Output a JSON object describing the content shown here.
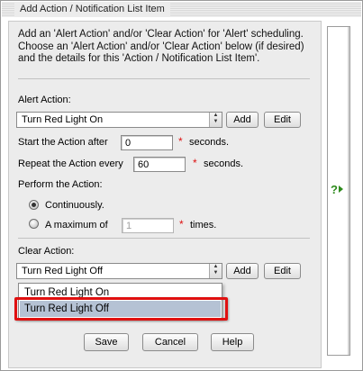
{
  "window": {
    "title": "Add Action / Notification List Item"
  },
  "intro": {
    "text": "Add an 'Alert Action' and/or 'Clear Action' for 'Alert' scheduling. Choose an 'Alert Action' and/or 'Clear Action' below (if desired) and the details for this 'Action / Notification List Item'."
  },
  "alert_action": {
    "label": "Alert Action:",
    "selected": "Turn Red Light On",
    "add_label": "Add",
    "edit_label": "Edit"
  },
  "start_after": {
    "label": "Start the Action after",
    "value": "0",
    "required_mark": "*",
    "unit": "seconds."
  },
  "repeat_every": {
    "label": "Repeat the Action every",
    "value": "60",
    "required_mark": "*",
    "unit": "seconds."
  },
  "perform": {
    "label": "Perform the Action:",
    "continuously_label": "Continuously.",
    "maximum_label": "A maximum of",
    "maximum_value": "1",
    "required_mark": "*",
    "times_unit": "times.",
    "selected_option": "continuously"
  },
  "clear_action": {
    "label": "Clear Action:",
    "selected": "Turn Red Light Off",
    "add_label": "Add",
    "edit_label": "Edit",
    "options": [
      "Turn Red Light On",
      "Turn Red Light Off"
    ],
    "highlighted_option": "Turn Red Light Off"
  },
  "footer": {
    "save_label": "Save",
    "cancel_label": "Cancel",
    "help_label": "Help"
  },
  "side_panel": {
    "help_glyph": "?"
  },
  "colors": {
    "panel_bg": "#ececec",
    "highlight_border": "#e01010",
    "selected_item_bg": "#b5c2d4",
    "help_green": "#2d8a1c",
    "required_red": "#d11111"
  }
}
